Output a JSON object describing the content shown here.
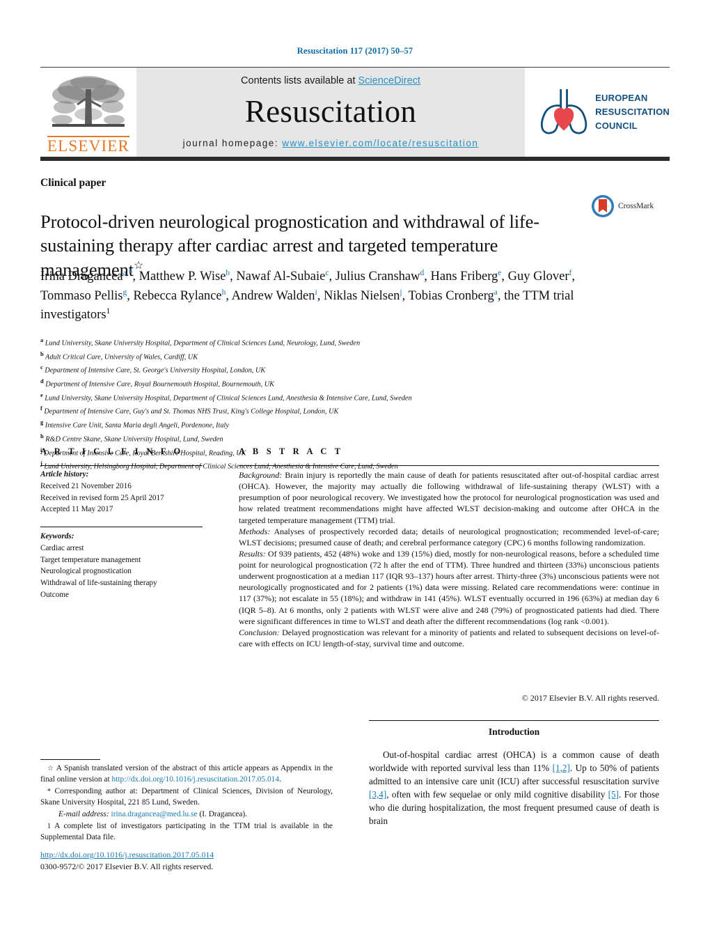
{
  "running_head": "Resuscitation 117 (2017) 50–57",
  "masthead": {
    "contents_prefix": "Contents lists available at ",
    "sciencedirect": "ScienceDirect",
    "journal_title": "Resuscitation",
    "homepage_prefix": "journal homepage: ",
    "homepage_url": "www.elsevier.com/locate/resuscitation",
    "elsevier_wordmark": "ELSEVIER",
    "erc_lines": [
      "EUROPEAN",
      "RESUSCITATION",
      "COUNCIL"
    ],
    "colors": {
      "link": "#2b8fc4",
      "band": "#e6e6e6",
      "elsevier_orange": "#E87722",
      "erc_blue": "#134f7d",
      "erc_red": "#E8474C"
    }
  },
  "article_type": "Clinical paper",
  "crossmark_label": "CrossMark",
  "title": "Protocol-driven neurological prognostication and withdrawal of life-sustaining therapy after cardiac arrest and targeted temperature management",
  "title_footnote_mark": "☆",
  "authors": [
    {
      "name": "Irina Dragancea",
      "sup": "a,*"
    },
    {
      "name": "Matthew P. Wise",
      "sup": "b"
    },
    {
      "name": "Nawaf Al-Subaie",
      "sup": "c"
    },
    {
      "name": "Julius Cranshaw",
      "sup": "d"
    },
    {
      "name": "Hans Friberg",
      "sup": "e"
    },
    {
      "name": "Guy Glover",
      "sup": "f"
    },
    {
      "name": "Tommaso Pellis",
      "sup": "g"
    },
    {
      "name": "Rebecca Rylance",
      "sup": "h"
    },
    {
      "name": "Andrew Walden",
      "sup": "i"
    },
    {
      "name": "Niklas Nielsen",
      "sup": "j"
    },
    {
      "name": "Tobias Cronberg",
      "sup": "a"
    },
    {
      "name": "the TTM trial investigators",
      "sup": "1"
    }
  ],
  "affiliations": [
    {
      "mark": "a",
      "text": "Lund University, Skane University Hospital, Department of Clinical Sciences Lund, Neurology, Lund, Sweden"
    },
    {
      "mark": "b",
      "text": "Adult Critical Care, University of Wales, Cardiff, UK"
    },
    {
      "mark": "c",
      "text": "Department of Intensive Care, St. George's University Hospital, London, UK"
    },
    {
      "mark": "d",
      "text": "Department of Intensive Care, Royal Bournemouth Hospital, Bournemouth, UK"
    },
    {
      "mark": "e",
      "text": "Lund University, Skane University Hospital, Department of Clinical Sciences Lund, Anesthesia & Intensive Care, Lund, Sweden"
    },
    {
      "mark": "f",
      "text": "Department of Intensive Care, Guy's and St. Thomas NHS Trust, King's College Hospital, London, UK"
    },
    {
      "mark": "g",
      "text": "Intensive Care Unit, Santa Maria degli Angeli, Pordenone, Italy"
    },
    {
      "mark": "h",
      "text": "R&D Centre Skane, Skane University Hospital, Lund, Sweden"
    },
    {
      "mark": "i",
      "text": "Department of Intensive Care, Royal Berkshire Hospital, Reading, UK"
    },
    {
      "mark": "j",
      "text": "Lund University, Helsingborg Hospital, Department of Clinical Sciences Lund, Anesthesia & Intensive Care, Lund, Sweden"
    }
  ],
  "article_info": {
    "heading": "A R T I C L E   I N F O",
    "history_label": "Article history:",
    "history": [
      "Received 21 November 2016",
      "Received in revised form 25 April 2017",
      "Accepted 11 May 2017"
    ],
    "keywords_label": "Keywords:",
    "keywords": [
      "Cardiac arrest",
      "Target temperature management",
      "Neurological prognostication",
      "Withdrawal of life-sustaining therapy",
      "Outcome"
    ]
  },
  "abstract": {
    "heading": "A B S T R A C T",
    "background_label": "Background:",
    "background": " Brain injury is reportedly the main cause of death for patients resuscitated after out-of-hospital cardiac arrest (OHCA). However, the majority may actually die following withdrawal of life-sustaining therapy (WLST) with a presumption of poor neurological recovery. We investigated how the protocol for neurological prognostication was used and how related treatment recommendations might have affected WLST decision-making and outcome after OHCA in the targeted temperature management (TTM) trial.",
    "methods_label": "Methods:",
    "methods": " Analyses of prospectively recorded data; details of neurological prognostication; recommended level-of-care; WLST decisions; presumed cause of death; and cerebral performance category (CPC) 6 months following randomization.",
    "results_label": "Results:",
    "results": " Of 939 patients, 452 (48%) woke and 139 (15%) died, mostly for non-neurological reasons, before a scheduled time point for neurological prognostication (72 h after the end of TTM). Three hundred and thirteen (33%) unconscious patients underwent prognostication at a median 117 (IQR 93–137) hours after arrest. Thirty-three (3%) unconscious patients were not neurologically prognosticated and for 2 patients (1%) data were missing. Related care recommendations were: continue in 117 (37%); not escalate in 55 (18%); and withdraw in 141 (45%). WLST eventually occurred in 196 (63%) at median day 6 (IQR 5–8). At 6 months, only 2 patients with WLST were alive and 248 (79%) of prognosticated patients had died. There were significant differences in time to WLST and death after the different recommendations (log rank <0.001).",
    "conclusion_label": "Conclusion:",
    "conclusion": " Delayed prognostication was relevant for a minority of patients and related to subsequent decisions on level-of-care with effects on ICU length-of-stay, survival time and outcome.",
    "copyright": "© 2017 Elsevier B.V. All rights reserved."
  },
  "introduction": {
    "heading": "Introduction",
    "paragraph_1": "Out-of-hospital cardiac arrest (OHCA) is a common cause of death worldwide with reported survival less than 11% ",
    "ref_1": "[1,2]",
    "paragraph_2": ". Up to 50% of patients admitted to an intensive care unit (ICU) after successful resuscitation survive ",
    "ref_2": "[3,4]",
    "paragraph_3": ", often with few sequelae or only mild cognitive disability ",
    "ref_3": "[5]",
    "paragraph_4": ". For those who die during hospitalization, the most frequent presumed cause of death is brain"
  },
  "footnotes": {
    "star_mark": "☆",
    "star_text_pre": " A Spanish translated version of the abstract of this article appears as Appendix in the final online version at ",
    "star_link": "http://dx.doi.org/10.1016/j.resuscitation.2017.05.014",
    "star_text_post": ".",
    "corr_mark": "*",
    "corr_text": " Corresponding author at: Department of Clinical Sciences, Division of Neurology, Skane University Hospital, 221 85 Lund, Sweden.",
    "email_label": "E-mail address:",
    "email": "irina.dragancea@med.lu.se",
    "email_suffix": " (I. Dragancea).",
    "one_mark": "1",
    "one_text": " A complete list of investigators participating in the TTM trial is available in the Supplemental Data file."
  },
  "doi_block": {
    "doi": "http://dx.doi.org/10.1016/j.resuscitation.2017.05.014",
    "issn_copyright": "0300-9572/© 2017 Elsevier B.V. All rights reserved."
  }
}
